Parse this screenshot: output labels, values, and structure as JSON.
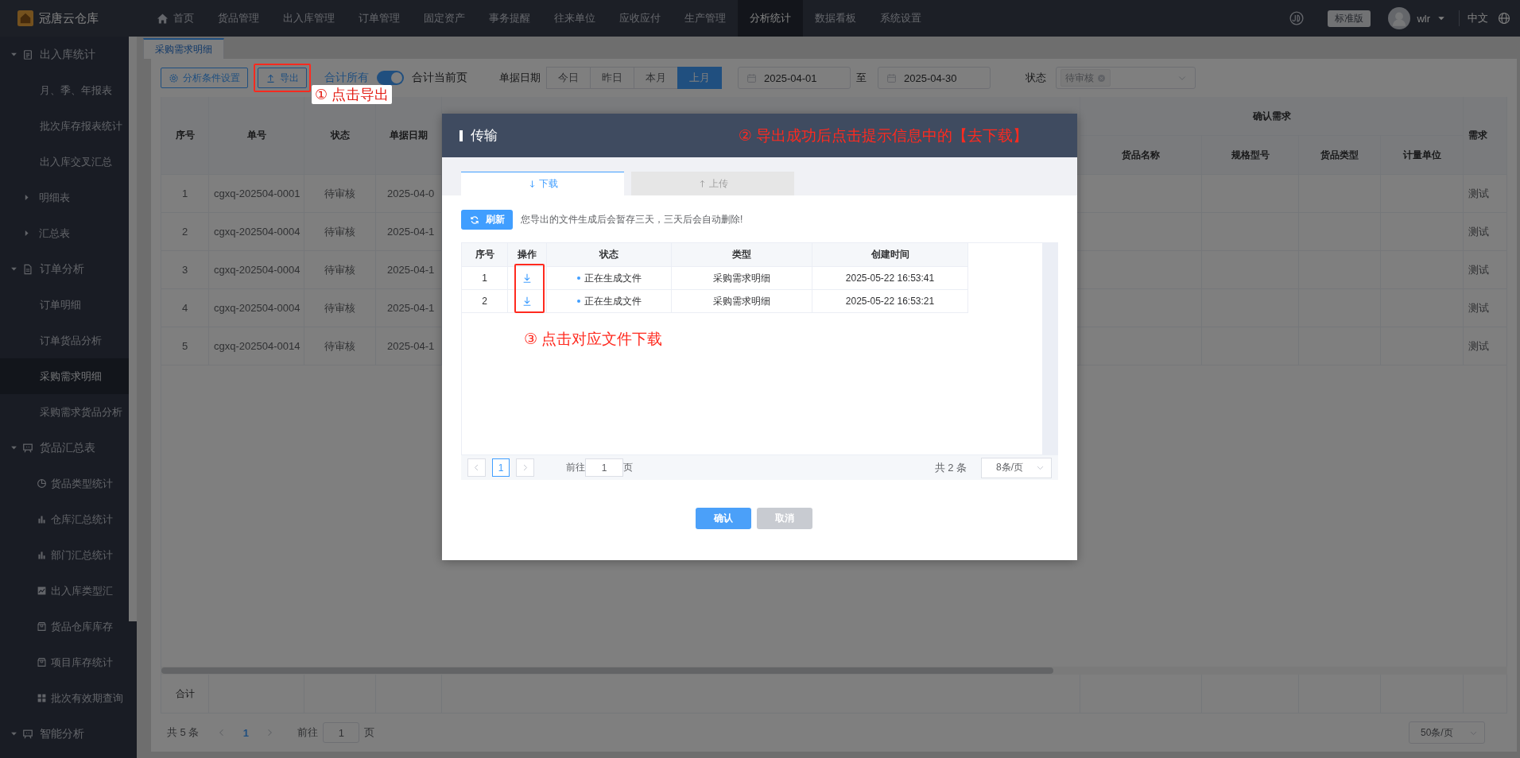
{
  "app": {
    "logo": "冠唐云仓库"
  },
  "top_nav": [
    {
      "label": "首页",
      "kind": "home",
      "selected": false
    },
    {
      "label": "货品管理",
      "selected": false
    },
    {
      "label": "出入库管理",
      "selected": false
    },
    {
      "label": "订单管理",
      "selected": false
    },
    {
      "label": "固定资产",
      "selected": false
    },
    {
      "label": "事务提醒",
      "selected": false
    },
    {
      "label": "往来单位",
      "selected": false
    },
    {
      "label": "应收应付",
      "selected": false
    },
    {
      "label": "生产管理",
      "selected": false
    },
    {
      "label": "分析统计",
      "selected": true
    },
    {
      "label": "数据看板",
      "selected": false
    },
    {
      "label": "系统设置",
      "selected": false
    }
  ],
  "user": {
    "edition": "标准版",
    "name": "wlr",
    "language": "中文"
  },
  "sidebar": {
    "items": [
      {
        "label": "出入库统计",
        "kind": "doc",
        "expanded": true,
        "selected": false,
        "children": [
          {
            "label": "月、季、年报表",
            "selected": false
          },
          {
            "label": "批次库存报表统计",
            "selected": false
          },
          {
            "label": "出入库交叉汇总",
            "selected": false
          },
          {
            "label": "明细表",
            "expanded": false,
            "selected": false
          },
          {
            "label": "汇总表",
            "expanded": false,
            "selected": false
          }
        ]
      },
      {
        "label": "订单分析",
        "kind": "file",
        "expanded": true,
        "selected": false,
        "children": [
          {
            "label": "订单明细",
            "selected": false
          },
          {
            "label": "订单货品分析",
            "selected": false
          },
          {
            "label": "采购需求明细",
            "selected": true
          },
          {
            "label": "采购需求货品分析",
            "selected": false
          }
        ]
      },
      {
        "label": "货品汇总表",
        "kind": "board",
        "expanded": true,
        "selected": false,
        "children": [
          {
            "label": "货品类型统计",
            "kind": "pie",
            "selected": false
          },
          {
            "label": "仓库汇总统计",
            "kind": "bars",
            "selected": false
          },
          {
            "label": "部门汇总统计",
            "kind": "bars",
            "selected": false
          },
          {
            "label": "出入库类型汇",
            "kind": "area",
            "selected": false
          },
          {
            "label": "货品仓库库存",
            "kind": "box",
            "selected": false
          },
          {
            "label": "项目库存统计",
            "kind": "box",
            "selected": false
          },
          {
            "label": "批次有效期查询",
            "kind": "grid",
            "selected": false
          }
        ]
      },
      {
        "label": "智能分析",
        "kind": "board",
        "expanded": true,
        "selected": false
      }
    ]
  },
  "page_tabs": [
    {
      "label": "采购需求明细",
      "selected": true
    }
  ],
  "toolbar": {
    "settings_button": "分析条件设置",
    "export_button": "导出",
    "export_annotation": "① 点击导出",
    "sum_all": "合计所有",
    "sum_toggle": {
      "on": true
    },
    "sum_page": "合计当前页",
    "date_label": "单据日期",
    "date_ranges": [
      {
        "label": "今日",
        "selected": false
      },
      {
        "label": "昨日",
        "selected": false
      },
      {
        "label": "本月",
        "selected": false
      },
      {
        "label": "上月",
        "selected": true
      }
    ],
    "start_date": "2025-04-01",
    "range_separator": "至",
    "end_date": "2025-04-30",
    "status_label": "状态",
    "status_tags": [
      "待审核"
    ]
  },
  "table": {
    "columns": [
      "序号",
      "单号",
      "状态",
      "单据日期"
    ],
    "group": {
      "label": "确认需求",
      "columns": [
        "货品名称",
        "规格型号",
        "货品类型",
        "计量单位"
      ]
    },
    "last_column": "需求",
    "rows": [
      {
        "no": "1",
        "code": "cgxq-202504-0001",
        "status": "待审核",
        "date": "2025-04-0",
        "last": "测试"
      },
      {
        "no": "2",
        "code": "cgxq-202504-0004",
        "status": "待审核",
        "date": "2025-04-1",
        "last": "测试"
      },
      {
        "no": "3",
        "code": "cgxq-202504-0004",
        "status": "待审核",
        "date": "2025-04-1",
        "last": "测试"
      },
      {
        "no": "4",
        "code": "cgxq-202504-0004",
        "status": "待审核",
        "date": "2025-04-1",
        "last": "测试"
      },
      {
        "no": "5",
        "code": "cgxq-202504-0014",
        "status": "待审核",
        "date": "2025-04-1",
        "last": "测试"
      }
    ],
    "sum_label": "合计"
  },
  "pagination": {
    "total": "共 5 条",
    "pages": [
      {
        "label": "1",
        "selected": true
      }
    ],
    "goto_label": "前往",
    "goto_value": "1",
    "page_unit": "页",
    "page_size": "50条/页"
  },
  "dialog": {
    "title": "传输",
    "title_annotation": "② 导出成功后点击提示信息中的【去下载】",
    "tabs": [
      {
        "label": "下载",
        "kind": "down",
        "selected": true
      },
      {
        "label": "上传",
        "kind": "up",
        "selected": false
      }
    ],
    "refresh_button": "刷新",
    "notice": "您导出的文件生成后会暂存三天，三天后会自动删除!",
    "columns": [
      "序号",
      "操作",
      "状态",
      "类型",
      "创建时间"
    ],
    "rows": [
      {
        "no": "1",
        "status": "正在生成文件",
        "color": "#409eff",
        "type": "采购需求明细",
        "created": "2025-05-22 16:53:41"
      },
      {
        "no": "2",
        "status": "正在生成文件",
        "color": "#409eff",
        "type": "采购需求明细",
        "created": "2025-05-22 16:53:21"
      }
    ],
    "table_annotation": "③ 点击对应文件下载",
    "pagination": {
      "pages": [
        {
          "label": "1",
          "selected": true
        }
      ],
      "goto_label": "前往",
      "goto_value": "1",
      "page_unit": "页",
      "total": "共 2 条",
      "page_size": "8条/页"
    },
    "buttons": [
      {
        "label": "确认",
        "kind": "primary"
      },
      {
        "label": "取消",
        "kind": "secondary"
      }
    ]
  }
}
